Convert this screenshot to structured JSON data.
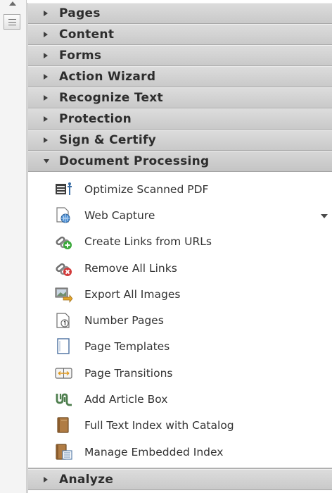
{
  "sections_before": [
    {
      "label": "Pages"
    },
    {
      "label": "Content"
    },
    {
      "label": "Forms"
    },
    {
      "label": "Action Wizard"
    },
    {
      "label": "Recognize Text"
    },
    {
      "label": "Protection"
    },
    {
      "label": "Sign & Certify"
    }
  ],
  "open_section": {
    "label": "Document Processing",
    "items": [
      {
        "label": "Optimize Scanned PDF",
        "icon": "optimize-scanned-pdf-icon"
      },
      {
        "label": "Web Capture",
        "icon": "web-capture-icon"
      },
      {
        "label": "Create Links from URLs",
        "icon": "create-links-icon"
      },
      {
        "label": "Remove All Links",
        "icon": "remove-links-icon"
      },
      {
        "label": "Export All Images",
        "icon": "export-images-icon"
      },
      {
        "label": "Number Pages",
        "icon": "number-pages-icon"
      },
      {
        "label": "Page Templates",
        "icon": "page-templates-icon"
      },
      {
        "label": "Page Transitions",
        "icon": "page-transitions-icon"
      },
      {
        "label": "Add Article Box",
        "icon": "article-box-icon"
      },
      {
        "label": "Full Text Index with Catalog",
        "icon": "full-text-index-icon"
      },
      {
        "label": "Manage Embedded Index",
        "icon": "embedded-index-icon"
      }
    ]
  },
  "sections_after": [
    {
      "label": "Analyze"
    }
  ],
  "colors": {
    "header_bg": "#d2d2d2",
    "text": "#2d2d2d",
    "link_green": "#3aa83a",
    "link_red": "#d23a3a",
    "book_brown": "#a8763e"
  }
}
